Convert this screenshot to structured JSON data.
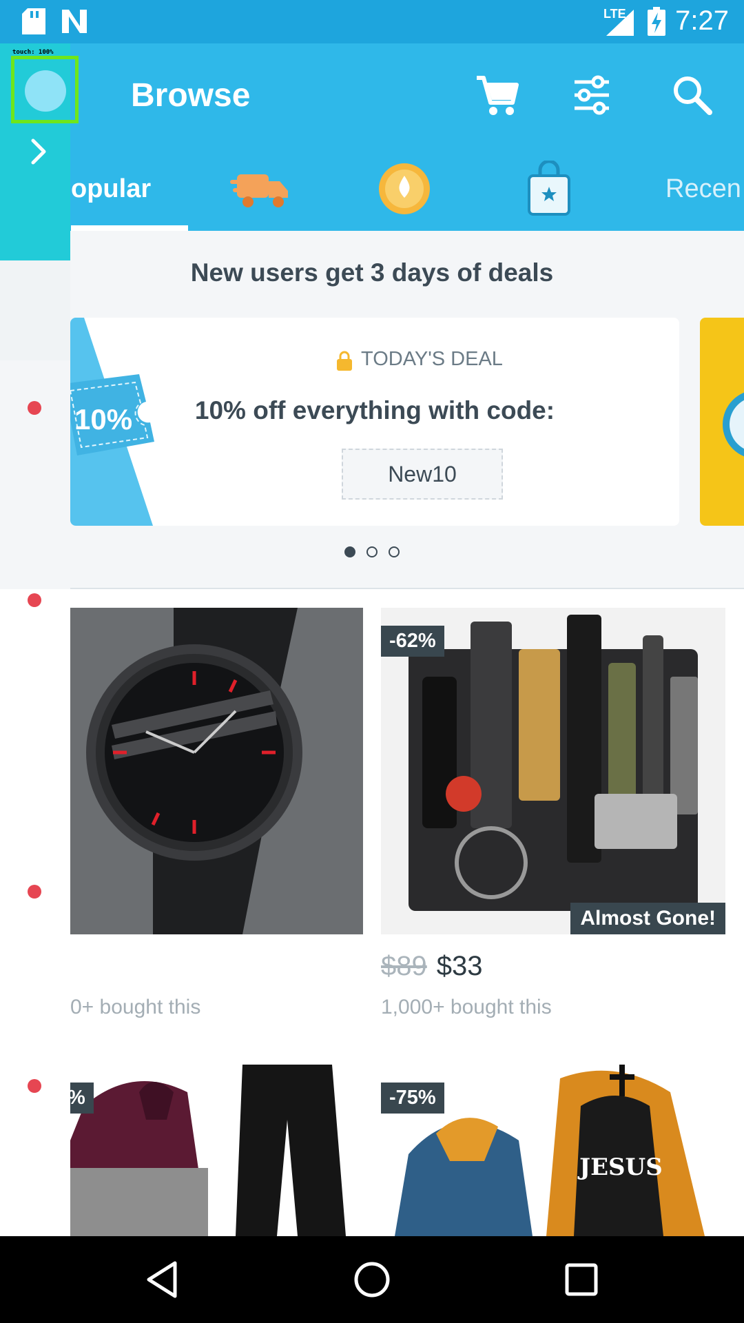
{
  "status_bar": {
    "time": "7:27",
    "network": "LTE",
    "icons": [
      "sd-card-icon",
      "n-notification-icon",
      "signal-icon",
      "battery-charging-icon"
    ]
  },
  "app_bar": {
    "title": "Browse",
    "actions": [
      "cart-icon",
      "filter-icon",
      "search-icon"
    ],
    "tabs": [
      {
        "label": "opular",
        "selected": true
      },
      {
        "label": "",
        "icon": "truck-icon"
      },
      {
        "label": "",
        "icon": "gold-coin-icon"
      },
      {
        "label": "",
        "icon": "shopping-bag-star-icon"
      },
      {
        "label": "Recen"
      }
    ]
  },
  "promo": {
    "headline": "New users get 3 days of deals",
    "deal_label": "TODAY'S DEAL",
    "deal_text": "10% off everything with code:",
    "code": "New10",
    "ticket_text": "10%",
    "carousel_pages": 3,
    "carousel_active": 1
  },
  "products": [
    {
      "name": "black-mesh-watch",
      "discount": "",
      "old_price": "",
      "price": "",
      "bought": "0+ bought this",
      "tag": ""
    },
    {
      "name": "survival-gear-kit",
      "discount": "-62%",
      "old_price": "$89",
      "price": "$33",
      "bought": "1,000+ bought this",
      "tag": "Almost Gone!"
    },
    {
      "name": "hoodie-pants-set",
      "discount": "%",
      "old_price": "",
      "price": "",
      "bought": "",
      "tag": ""
    },
    {
      "name": "jesus-hoodie",
      "discount": "-75%",
      "old_price": "",
      "price": "",
      "bought": "",
      "tag": ""
    }
  ],
  "overlay": {
    "touch_label": "touch: 100%"
  },
  "nav_bar": {
    "buttons": [
      "back-icon",
      "home-icon",
      "recents-icon"
    ]
  },
  "colors": {
    "primary": "#2fb8e9",
    "status_bar": "#1ea5dd",
    "badge": "#39474f",
    "text_dark": "#3c4a55",
    "overlay": "#22cbd8"
  }
}
